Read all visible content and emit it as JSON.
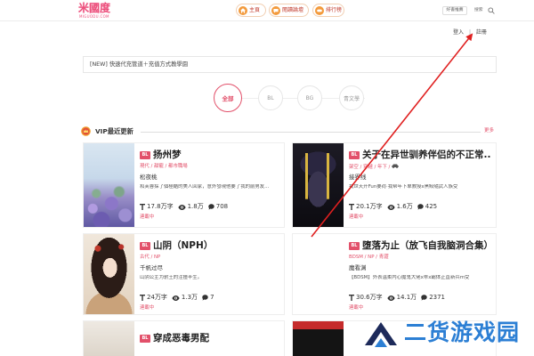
{
  "header": {
    "logo": {
      "text": "米國度",
      "subtitle": "MIGUODU.COM"
    },
    "nav": [
      {
        "label": "主頁",
        "icon": "home-icon"
      },
      {
        "label": "閱讀論壇",
        "icon": "forum-icon"
      },
      {
        "label": "排行榜",
        "icon": "rank-icon"
      }
    ],
    "recommend_label": "好書推薦",
    "search_label": "搜索",
    "search_icon": "search-icon"
  },
  "account": {
    "login": "登入",
    "separator": "|",
    "register": "註冊"
  },
  "announcement": "[NEW] 快速代充管道＋充值方式教學園",
  "category_tabs": [
    {
      "label": "全部",
      "selected": true
    },
    {
      "label": "BL",
      "selected": false
    },
    {
      "label": "BG",
      "selected": false
    },
    {
      "label": "青文學",
      "selected": false
    }
  ],
  "section": {
    "icon": "vip-icon",
    "title": "VIP最近更新",
    "more": "更多"
  },
  "stat_icons": {
    "words": "word-count-icon",
    "views": "eye-icon",
    "comments": "comment-icon"
  },
  "cards": [
    {
      "badge": "BL",
      "title": "扬州梦",
      "tags": "現代 / 甜寵 / 都市職場",
      "author": "松夜桃",
      "desc": "和芙蓉採了個極酷的美人回家，意外發現他要了我的前男友...",
      "words": "17.8万字",
      "views": "1.8万",
      "comments": "708",
      "status": "連載中"
    },
    {
      "badge": "BL",
      "title": "关于在异世驯养伴侣的不正常...",
      "tags": "架空 / 穿越 / 年下 /",
      "tag_icon": "car-icon",
      "author": "接界线",
      "desc": "我世天开Fun要荷·我帮年下单教授x黑鲛隨武人族受",
      "words": "20.1万字",
      "views": "1.6万",
      "comments": "425",
      "status": "連載中"
    },
    {
      "badge": "BL",
      "title": "山阴（NPH）",
      "tags": "古代 / NP",
      "author": "千帆过尽",
      "desc": "山阴公主为驸王的注撞半生。",
      "words": "24万字",
      "views": "1.3万",
      "comments": "7",
      "status": "連載中"
    },
    {
      "badge": "BL",
      "title": "堕落为止（放飞自我脑洞合集）",
      "tags": "BDSM / NP / 青澀",
      "author": "魔看渊",
      "desc": "【BDSM】外表温柔内心魔鬼大佬x乖x霸体正直新兵m受",
      "words": "30.6万字",
      "views": "14.1万",
      "comments": "2371",
      "status": "連載中"
    },
    {
      "badge": "BL",
      "title": "穿成恶毒男配"
    }
  ],
  "watermark": {
    "text": "二货游戏园"
  },
  "colors": {
    "accent": "#e2506a",
    "nav_icon": "#f39a3c",
    "arrow": "#e02020",
    "watermark": "#2c7fd4",
    "watermark_dark": "#1d2a5a"
  }
}
